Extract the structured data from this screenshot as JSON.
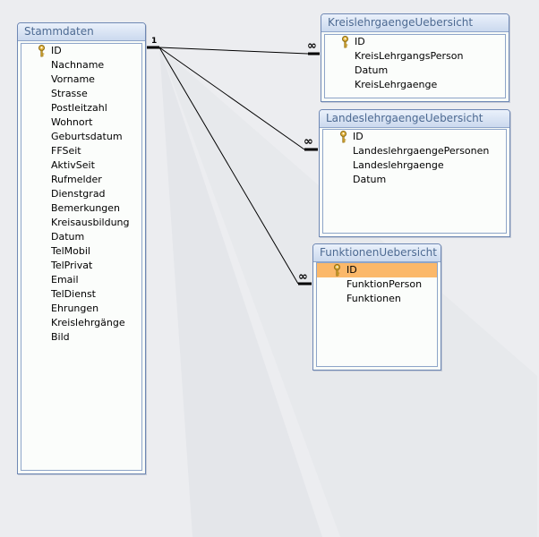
{
  "tables": {
    "stammdaten": {
      "title": "Stammdaten",
      "fields": [
        "ID",
        "Nachname",
        "Vorname",
        "Strasse",
        "Postleitzahl",
        "Wohnort",
        "Geburtsdatum",
        "FFSeit",
        "AktivSeit",
        "Rufmelder",
        "Dienstgrad",
        "Bemerkungen",
        "Kreisausbildung",
        "Datum",
        "TelMobil",
        "TelPrivat",
        "Email",
        "TelDienst",
        "Ehrungen",
        "Kreislehrgänge",
        "Bild"
      ]
    },
    "kreis": {
      "title": "KreislehrgaengeUebersicht",
      "fields": [
        "ID",
        "KreisLehrgangsPerson",
        "Datum",
        "KreisLehrgaenge"
      ]
    },
    "landes": {
      "title": "LandeslehrgaengeUebersicht",
      "fields": [
        "ID",
        "LandeslehrgaengePersonen",
        "Landeslehrgaenge",
        "Datum"
      ]
    },
    "funktionen": {
      "title": "FunktionenUebersicht",
      "fields": [
        "ID",
        "FunktionPerson",
        "Funktionen"
      ]
    }
  },
  "relationships": {
    "one_label": "1",
    "many_label": "∞"
  },
  "colors": {
    "background": "#ecedf0",
    "table_border": "#6f88b4",
    "title_text": "#4d6a92",
    "selected_field": "#fbb869"
  },
  "icons": {
    "primary_key": "key-icon"
  }
}
